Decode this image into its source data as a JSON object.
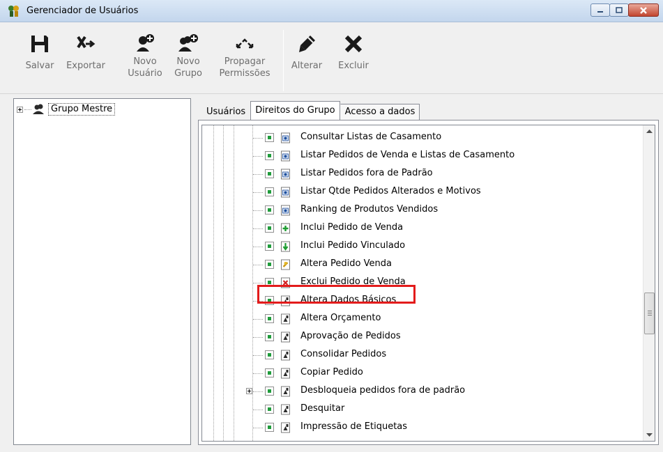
{
  "window": {
    "title": "Gerenciador de Usuários"
  },
  "toolbar": {
    "save_label": "Salvar",
    "export_label": "Exportar",
    "new_user_label_1": "Novo",
    "new_user_label_2": "Usuário",
    "new_group_label_1": "Novo",
    "new_group_label_2": "Grupo",
    "propagate_label_1": "Propagar",
    "propagate_label_2": "Permissões",
    "edit_label": "Alterar",
    "delete_label": "Excluir"
  },
  "left_tree": {
    "group_label": "Grupo Mestre"
  },
  "tabs": [
    "Usuários",
    "Direitos do Grupo",
    "Acesso a dados"
  ],
  "permissions": [
    "Consultar Listas de Casamento",
    "Listar Pedidos de Venda e Listas de Casamento",
    "Listar Pedidos fora de Padrão",
    "Listar Qtde Pedidos Alterados e Motivos",
    "Ranking de Produtos Vendidos",
    "Inclui Pedido de Venda",
    "Inclui Pedido Vinculado",
    "Altera Pedido Venda",
    "Exclui Pedido de Venda",
    "Altera Dados Básicos",
    "Altera Orçamento",
    "Aprovação de Pedidos",
    "Consolidar Pedidos",
    "Copiar Pedido",
    "Desbloqueia pedidos fora de padrão",
    "Desquitar",
    "Impressão de Etiquetas"
  ],
  "highlight_color": "#e31b1b"
}
